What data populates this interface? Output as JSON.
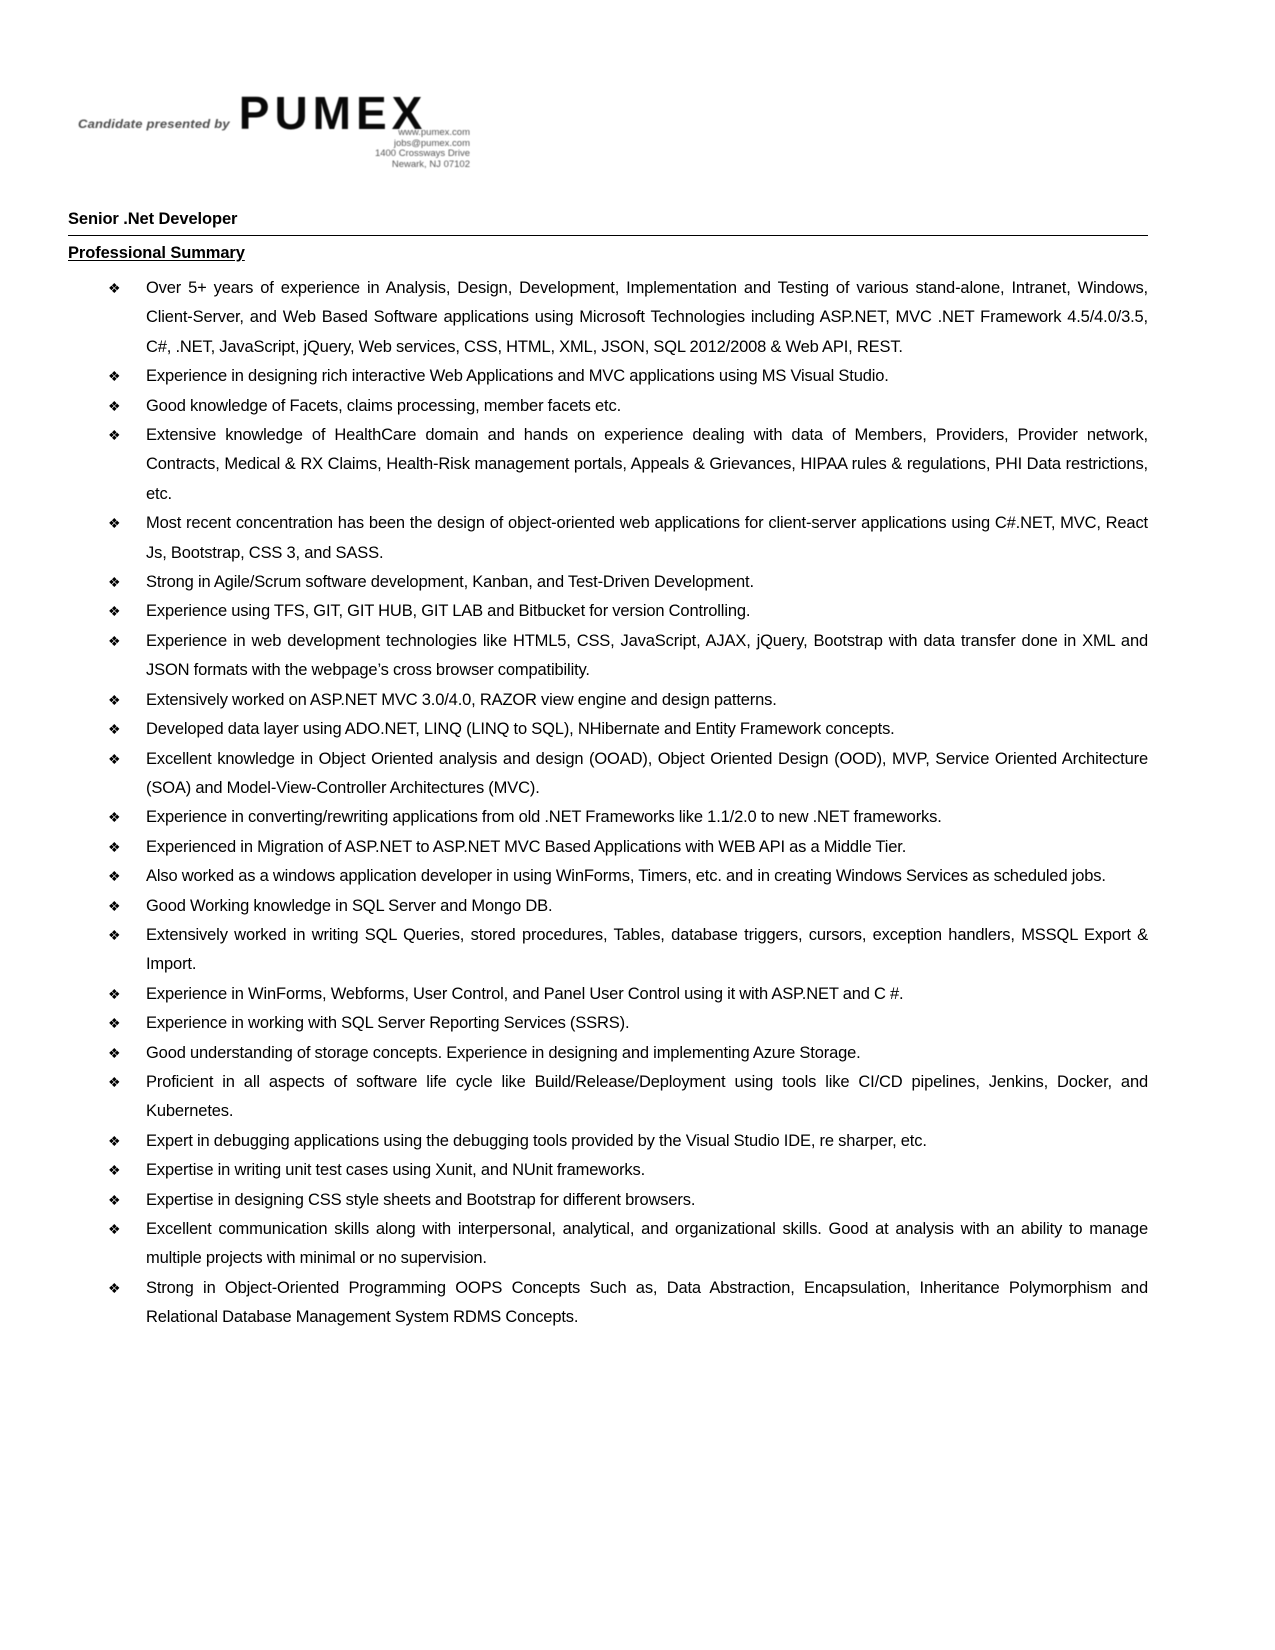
{
  "header": {
    "presented_by_label": "Candidate presented by",
    "logo_text": "PUMEX",
    "contact_lines": [
      "www.pumex.com",
      "jobs@pumex.com",
      "1400 Crossways Drive",
      "Newark, NJ 07102"
    ]
  },
  "document": {
    "job_title": "Senior .Net Developer",
    "section_heading": "Professional Summary",
    "bullet_marker": "diamond-cluster-bullet",
    "bullet_glyph": "❖",
    "bullets": [
      "Over 5+ years of experience in Analysis, Design, Development, Implementation and Testing of various stand-alone, Intranet, Windows, Client-Server, and Web Based Software applications using Microsoft Technologies including ASP.NET, MVC .NET Framework 4.5/4.0/3.5, C#, .NET, JavaScript, jQuery, Web services, CSS, HTML, XML, JSON, SQL 2012/2008 & Web API, REST.",
      "Experience in designing rich interactive Web Applications and MVC applications using MS Visual Studio.",
      "Good knowledge of Facets, claims processing, member facets etc.",
      "Extensive knowledge of HealthCare domain and hands on experience dealing with data of Members, Providers, Provider network, Contracts, Medical & RX Claims, Health-Risk management portals, Appeals & Grievances, HIPAA rules & regulations, PHI Data restrictions, etc.",
      "Most recent concentration has been the design of object-oriented web applications for client-server applications using C#.NET, MVC, React Js, Bootstrap, CSS 3, and SASS.",
      "Strong in Agile/Scrum software development, Kanban, and Test-Driven Development.",
      "Experience using TFS, GIT, GIT HUB, GIT LAB and Bitbucket for version Controlling.",
      "Experience in web development technologies like HTML5, CSS, JavaScript, AJAX, jQuery, Bootstrap with data transfer done in XML and JSON formats with the webpage’s cross browser compatibility.",
      "Extensively worked on ASP.NET MVC 3.0/4.0, RAZOR view engine and design patterns.",
      "Developed data layer using ADO.NET, LINQ (LINQ to SQL), NHibernate and Entity Framework concepts.",
      "Excellent knowledge in Object Oriented analysis and design (OOAD), Object Oriented Design (OOD), MVP, Service Oriented Architecture (SOA) and Model-View-Controller Architectures (MVC).",
      "Experience in converting/rewriting applications from old .NET Frameworks like 1.1/2.0 to new .NET frameworks.",
      "Experienced in Migration of ASP.NET to ASP.NET MVC Based Applications with WEB API as a Middle Tier.",
      "Also worked as a windows application developer in using WinForms, Timers, etc. and in creating Windows Services as scheduled jobs.",
      "Good Working knowledge in SQL Server and Mongo DB.",
      "Extensively worked in writing SQL Queries, stored procedures, Tables, database triggers, cursors, exception handlers, MSSQL Export & Import.",
      "Experience in WinForms, Webforms, User Control, and Panel User Control using it with ASP.NET and C #.",
      "Experience in working with SQL Server Reporting Services (SSRS).",
      "Good understanding of storage concepts. Experience in designing and implementing Azure Storage.",
      "Proficient in all aspects of software life cycle like Build/Release/Deployment using tools like CI/CD pipelines, Jenkins, Docker, and Kubernetes.",
      "Expert in debugging applications using the debugging tools provided by the Visual Studio IDE, re sharper, etc.",
      "Expertise in writing unit test cases using Xunit, and NUnit frameworks.",
      "Expertise in designing CSS style sheets and Bootstrap for different browsers.",
      "Excellent communication skills along with interpersonal, analytical, and organizational skills. Good at analysis with an ability to manage multiple projects with minimal or no supervision.",
      "Strong in Object-Oriented Programming OOPS Concepts Such as, Data Abstraction, Encapsulation, Inheritance Polymorphism and Relational Database Management System RDMS Concepts."
    ]
  }
}
